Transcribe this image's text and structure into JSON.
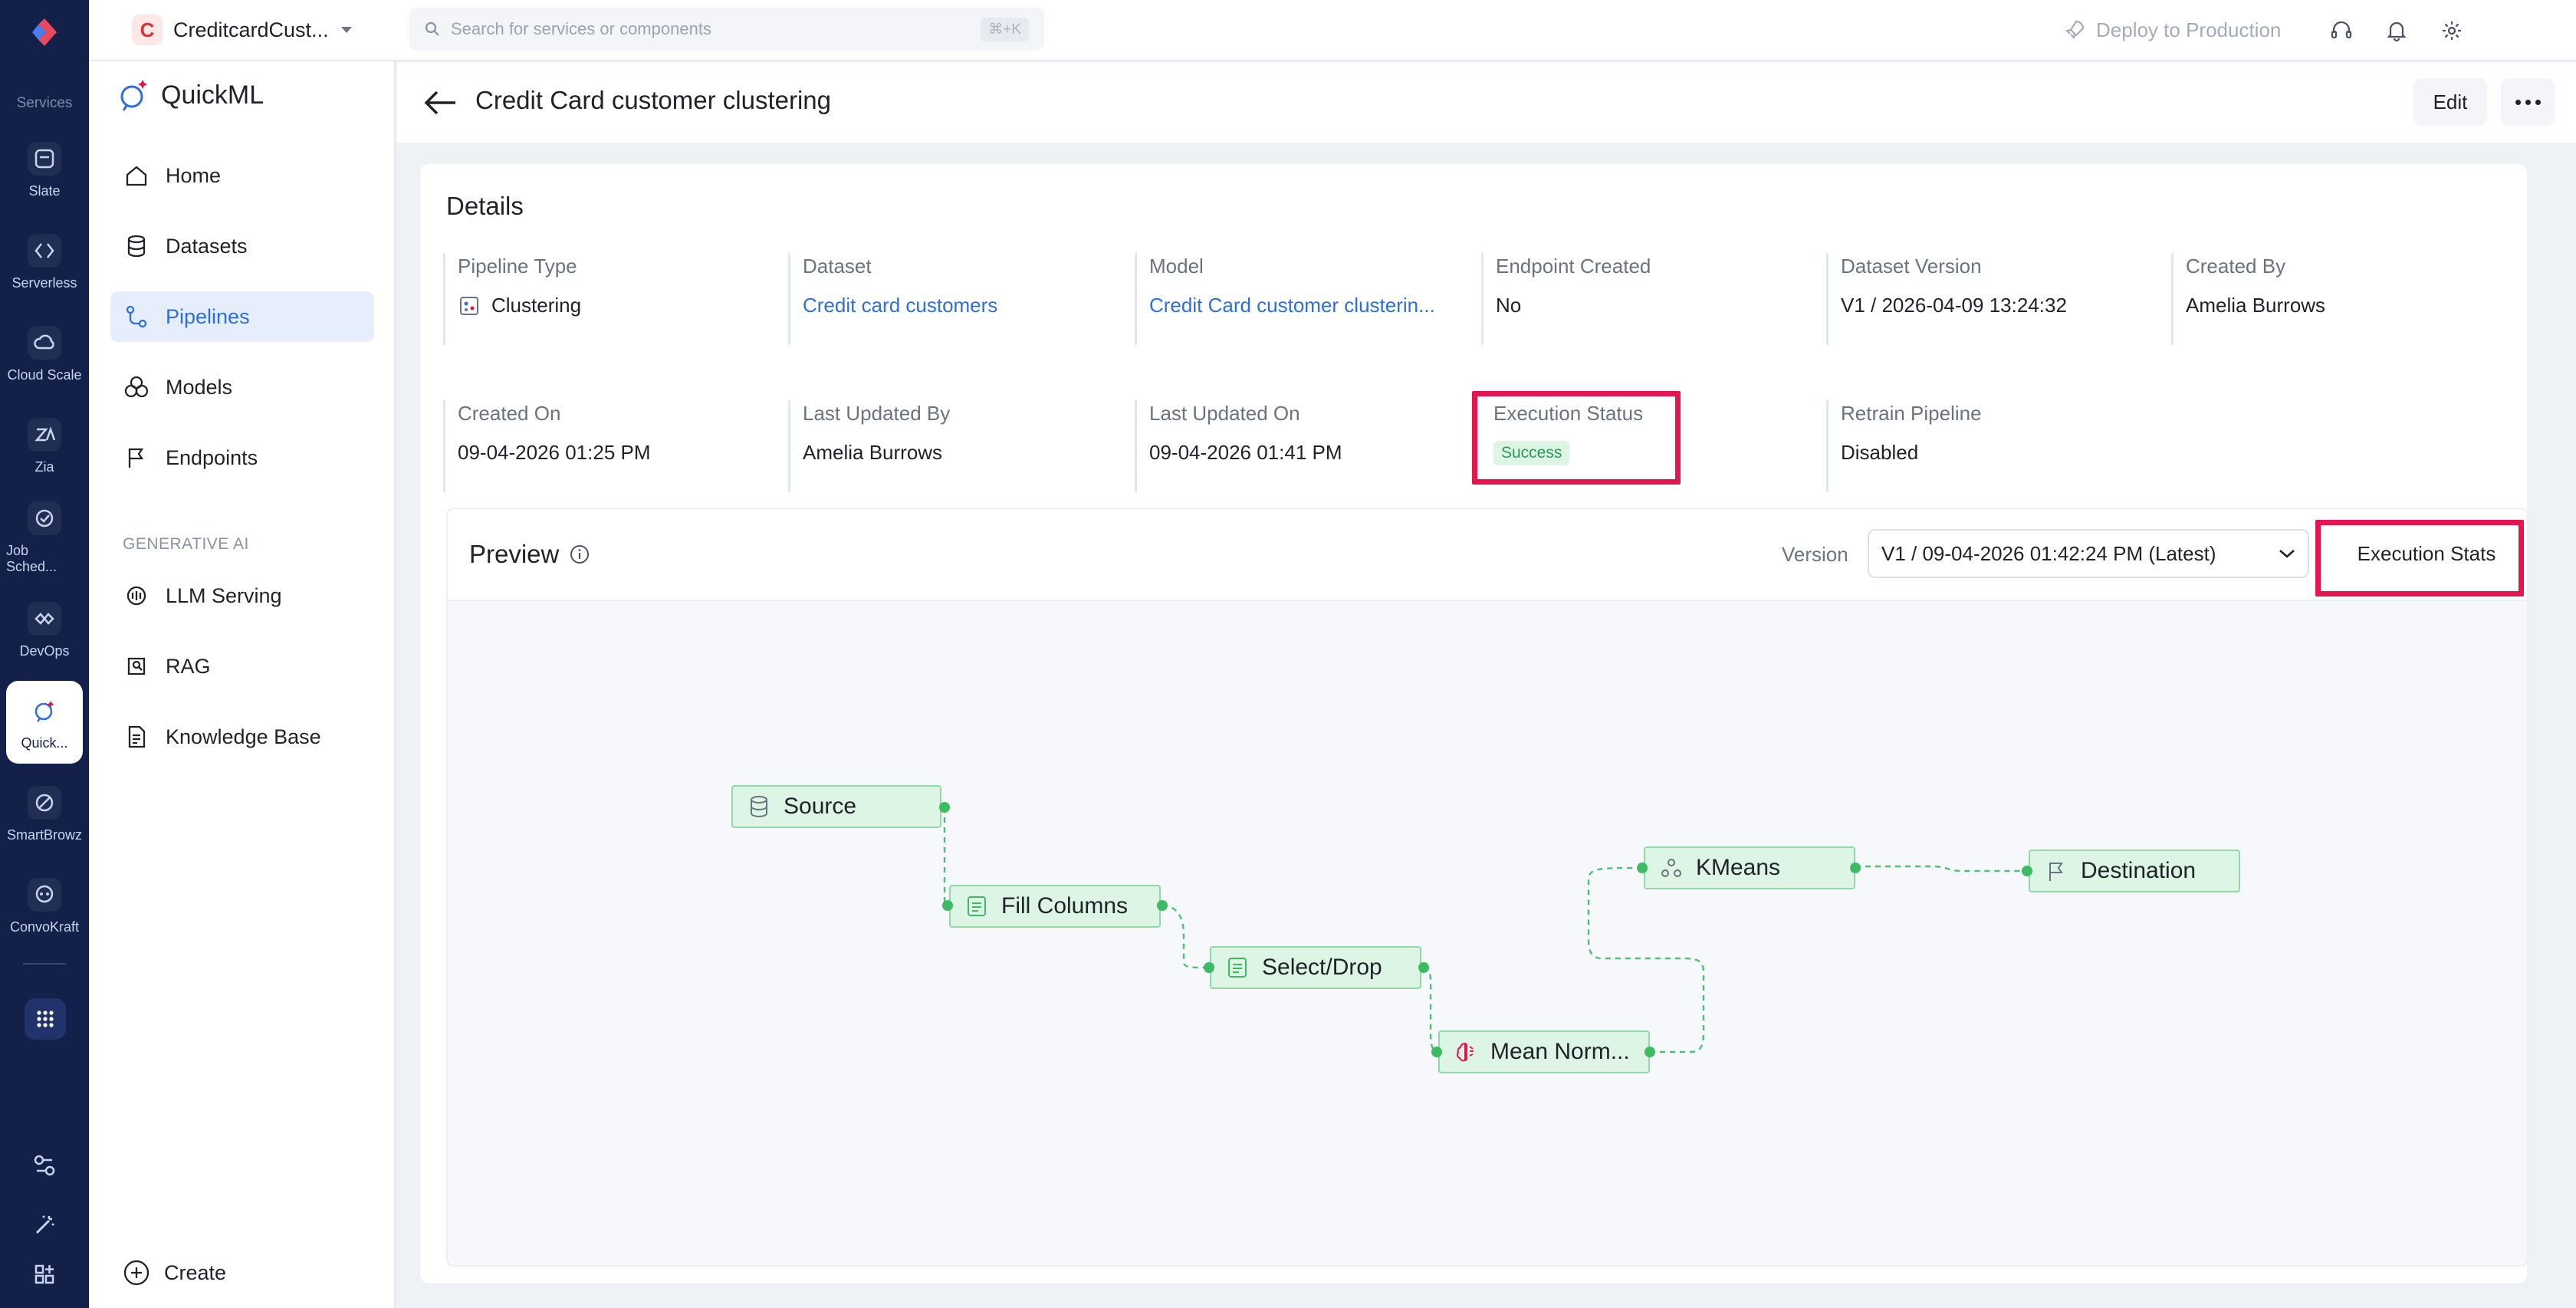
{
  "rail": {
    "services_label": "Services",
    "items": [
      {
        "label": "Slate",
        "icon": "slate-icon"
      },
      {
        "label": "Serverless",
        "icon": "serverless-icon"
      },
      {
        "label": "Cloud Scale",
        "icon": "cloud-scale-icon"
      },
      {
        "label": "Zia",
        "icon": "zia-icon"
      },
      {
        "label": "Job Sched...",
        "icon": "job-scheduling-icon"
      },
      {
        "label": "DevOps",
        "icon": "devops-icon"
      },
      {
        "label": "Quick...",
        "icon": "quickml-icon"
      },
      {
        "label": "SmartBrowz",
        "icon": "smartbrowz-icon"
      },
      {
        "label": "ConvoKraft",
        "icon": "convokraft-icon"
      }
    ]
  },
  "topbar": {
    "project_initial": "C",
    "project_name": "CreditcardCust...",
    "search_placeholder": "Search for services or components",
    "search_shortcut": "⌘+K",
    "deploy_label": "Deploy to Production"
  },
  "sidebar": {
    "brand": "QuickML",
    "items": [
      {
        "label": "Home"
      },
      {
        "label": "Datasets"
      },
      {
        "label": "Pipelines"
      },
      {
        "label": "Models"
      },
      {
        "label": "Endpoints"
      }
    ],
    "section_label": "GENERATIVE AI",
    "gen_items": [
      {
        "label": "LLM Serving"
      },
      {
        "label": "RAG"
      },
      {
        "label": "Knowledge Base"
      }
    ],
    "create_label": "Create"
  },
  "header": {
    "title": "Credit Card customer clustering",
    "edit_label": "Edit"
  },
  "details": {
    "title": "Details",
    "pipeline_type": {
      "label": "Pipeline Type",
      "value": "Clustering"
    },
    "dataset": {
      "label": "Dataset",
      "value": "Credit card customers"
    },
    "model": {
      "label": "Model",
      "value": "Credit Card customer clusterin..."
    },
    "endpoint_created": {
      "label": "Endpoint Created",
      "value": "No"
    },
    "dataset_version": {
      "label": "Dataset Version",
      "value": "V1 / 2026-04-09 13:24:32"
    },
    "created_by": {
      "label": "Created By",
      "value": "Amelia Burrows"
    },
    "created_on": {
      "label": "Created On",
      "value": "09-04-2026 01:25 PM"
    },
    "last_updated_by": {
      "label": "Last Updated By",
      "value": "Amelia Burrows"
    },
    "last_updated_on": {
      "label": "Last Updated On",
      "value": "09-04-2026 01:41 PM"
    },
    "execution_status": {
      "label": "Execution Status",
      "value": "Success"
    },
    "retrain_pipeline": {
      "label": "Retrain Pipeline",
      "value": "Disabled"
    }
  },
  "preview": {
    "title": "Preview",
    "version_label": "Version",
    "version_value": "V1 / 09-04-2026 01:42:24 PM (Latest)",
    "execution_stats_label": "Execution Stats",
    "nodes": {
      "source": "Source",
      "fill_columns": "Fill Columns",
      "select_drop": "Select/Drop",
      "mean_norm": "Mean Norm...",
      "kmeans": "KMeans",
      "destination": "Destination"
    }
  },
  "colors": {
    "rail_bg": "#13214a",
    "accent": "#2f6fd8",
    "highlight": "#e5154f",
    "node_bg": "#dcf5e4",
    "node_border": "#8fd9a6",
    "connector": "#3dbb62"
  }
}
